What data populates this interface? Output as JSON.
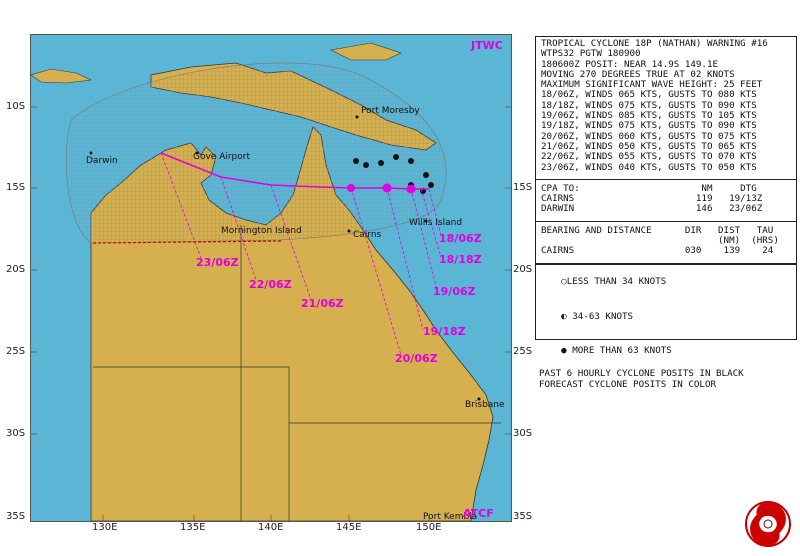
{
  "map": {
    "agency_top": "JTWC",
    "agency_bottom": "ATCF",
    "lat_labels": [
      "10S",
      "15S",
      "20S",
      "25S",
      "30S",
      "35S"
    ],
    "lon_labels": [
      "130E",
      "135E",
      "140E",
      "145E",
      "150E"
    ],
    "places": {
      "port_moresby": "Port Moresby",
      "darwin": "Darwin",
      "gove_airport": "Gove Airport",
      "mornington_island": "Mornington Island",
      "cairns": "Cairns",
      "willis_island": "Willis Island",
      "brisbane": "Brisbane",
      "port_kembla": "Port Kembla"
    },
    "forecast_labels": [
      "18/06Z",
      "18/18Z",
      "19/06Z",
      "19/18Z",
      "20/06Z",
      "21/06Z",
      "22/06Z",
      "23/06Z"
    ],
    "colors": {
      "ocean": "#5bb6d6",
      "land": "#d6b04e",
      "forecast": "#e000e0",
      "grid_hatch": "#9a9a9a"
    }
  },
  "warning": {
    "lines": [
      "TROPICAL CYCLONE 18P (NATHAN) WARNING #16",
      "WTPS32 PGTW 180900",
      "180600Z POSIT: NEAR 14.9S 149.1E",
      "MOVING 270 DEGREES TRUE AT 02 KNOTS",
      "MAXIMUM SIGNIFICANT WAVE HEIGHT: 25 FEET",
      "18/06Z, WINDS 065 KTS, GUSTS TO 080 KTS",
      "18/18Z, WINDS 075 KTS, GUSTS TO 090 KTS",
      "19/06Z, WINDS 085 KTS, GUSTS TO 105 KTS",
      "19/18Z, WINDS 075 KTS, GUSTS TO 090 KTS",
      "20/06Z, WINDS 060 KTS, GUSTS TO 075 KTS",
      "21/06Z, WINDS 050 KTS, GUSTS TO 065 KTS",
      "22/06Z, WINDS 055 KTS, GUSTS TO 070 KTS",
      "23/06Z, WINDS 040 KTS, GUSTS TO 050 KTS"
    ],
    "cpa_header": "CPA TO:                      NM     DTG",
    "cpa_rows": [
      "CAIRNS                      119   19/13Z",
      "DARWIN                      146   23/06Z"
    ],
    "bearing_header_1": "BEARING AND DISTANCE      DIR   DIST   TAU",
    "bearing_header_2": "                                (NM)  (HRS)",
    "bearing_rows": [
      "CAIRNS                    030    139    24"
    ]
  },
  "legend": {
    "items": [
      "LESS THAN 34 KNOTS",
      "34-63 KNOTS",
      "MORE THAN 63 KNOTS"
    ],
    "note_1": "PAST 6 HOURLY CYCLONE POSITS IN BLACK",
    "note_2": "FORECAST CYCLONE POSITS IN COLOR"
  }
}
